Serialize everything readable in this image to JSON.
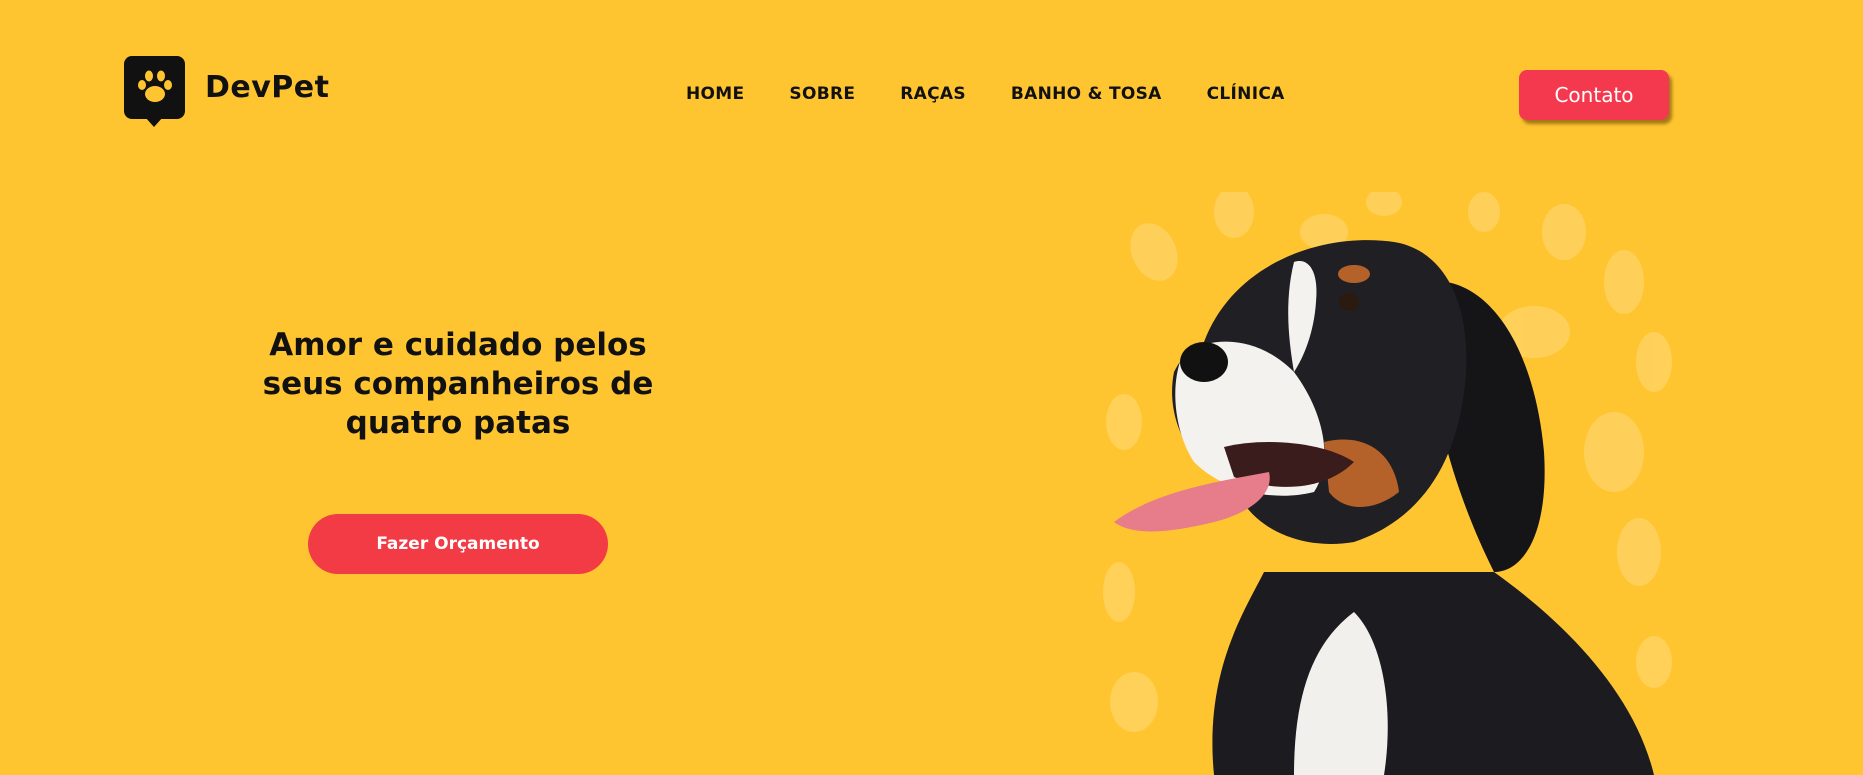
{
  "brand": {
    "name": "DevPet",
    "logo_icon": "paw-icon"
  },
  "nav": {
    "items": [
      "HOME",
      "SOBRE",
      "RAÇAS",
      "BANHO & TOSA",
      "CLÍNICA"
    ]
  },
  "header": {
    "contact_label": "Contato"
  },
  "hero": {
    "title": "Amor e cuidado pelos seus companheiros de quatro patas",
    "cta_label": "Fazer Orçamento",
    "image": "bernese-mountain-dog-photo"
  },
  "colors": {
    "background": "#FFC530",
    "accent": "#F4394F",
    "text": "#111111"
  }
}
